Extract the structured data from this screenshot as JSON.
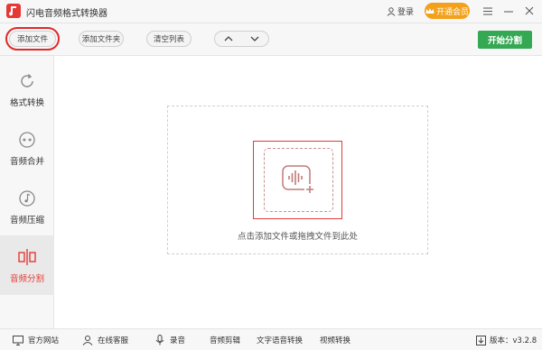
{
  "app": {
    "title": "闪电音频格式转换器",
    "login_label": "登录",
    "vip_label": "开通会员",
    "accent_color": "#e53935",
    "green_color": "#34a853"
  },
  "window_controls": [
    "menu-icon",
    "minimize-icon",
    "close-icon"
  ],
  "toolbar": {
    "add_file": "添加文件",
    "add_folder": "添加文件夹",
    "clear_list": "清空列表",
    "start_label": "开始分割"
  },
  "sidebar": {
    "items": [
      {
        "label": "格式转换",
        "icon": "refresh-icon"
      },
      {
        "label": "音频合并",
        "icon": "merge-icon"
      },
      {
        "label": "音频压缩",
        "icon": "music-note-icon"
      },
      {
        "label": "音频分割",
        "icon": "split-icon",
        "active": true
      }
    ]
  },
  "main": {
    "drop_hint": "点击添加文件或拖拽文件到此处"
  },
  "statusbar": {
    "items": [
      {
        "label": "官方网站",
        "icon": "monitor-icon"
      },
      {
        "label": "在线客服",
        "icon": "support-icon"
      },
      {
        "label": "录音",
        "icon": "mic-icon"
      },
      {
        "label": "音频剪辑",
        "icon": ""
      },
      {
        "label": "文字语音转换",
        "icon": ""
      },
      {
        "label": "视频转换",
        "icon": ""
      }
    ],
    "version": "版本：v3.2.8"
  }
}
